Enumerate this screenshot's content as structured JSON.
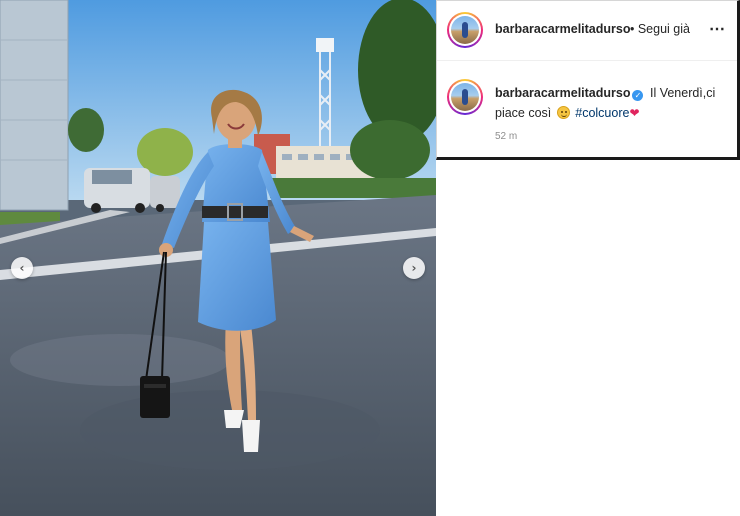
{
  "post": {
    "username": "barbaracarmelitadurso",
    "follow_label": "• Segui già",
    "more_icon": "⋯",
    "caption_text": "Il Venerdì,ci piace così",
    "hashtag": "#colcuore",
    "heart_glyph": "❤",
    "time_ago": "52 m"
  },
  "photo": {
    "prev_glyph": "‹",
    "next_glyph": "›"
  },
  "colors": {
    "verified": "#3897f0",
    "hashtag": "#00376b",
    "heart": "#e0245e",
    "dress": "#5b9ee0"
  }
}
